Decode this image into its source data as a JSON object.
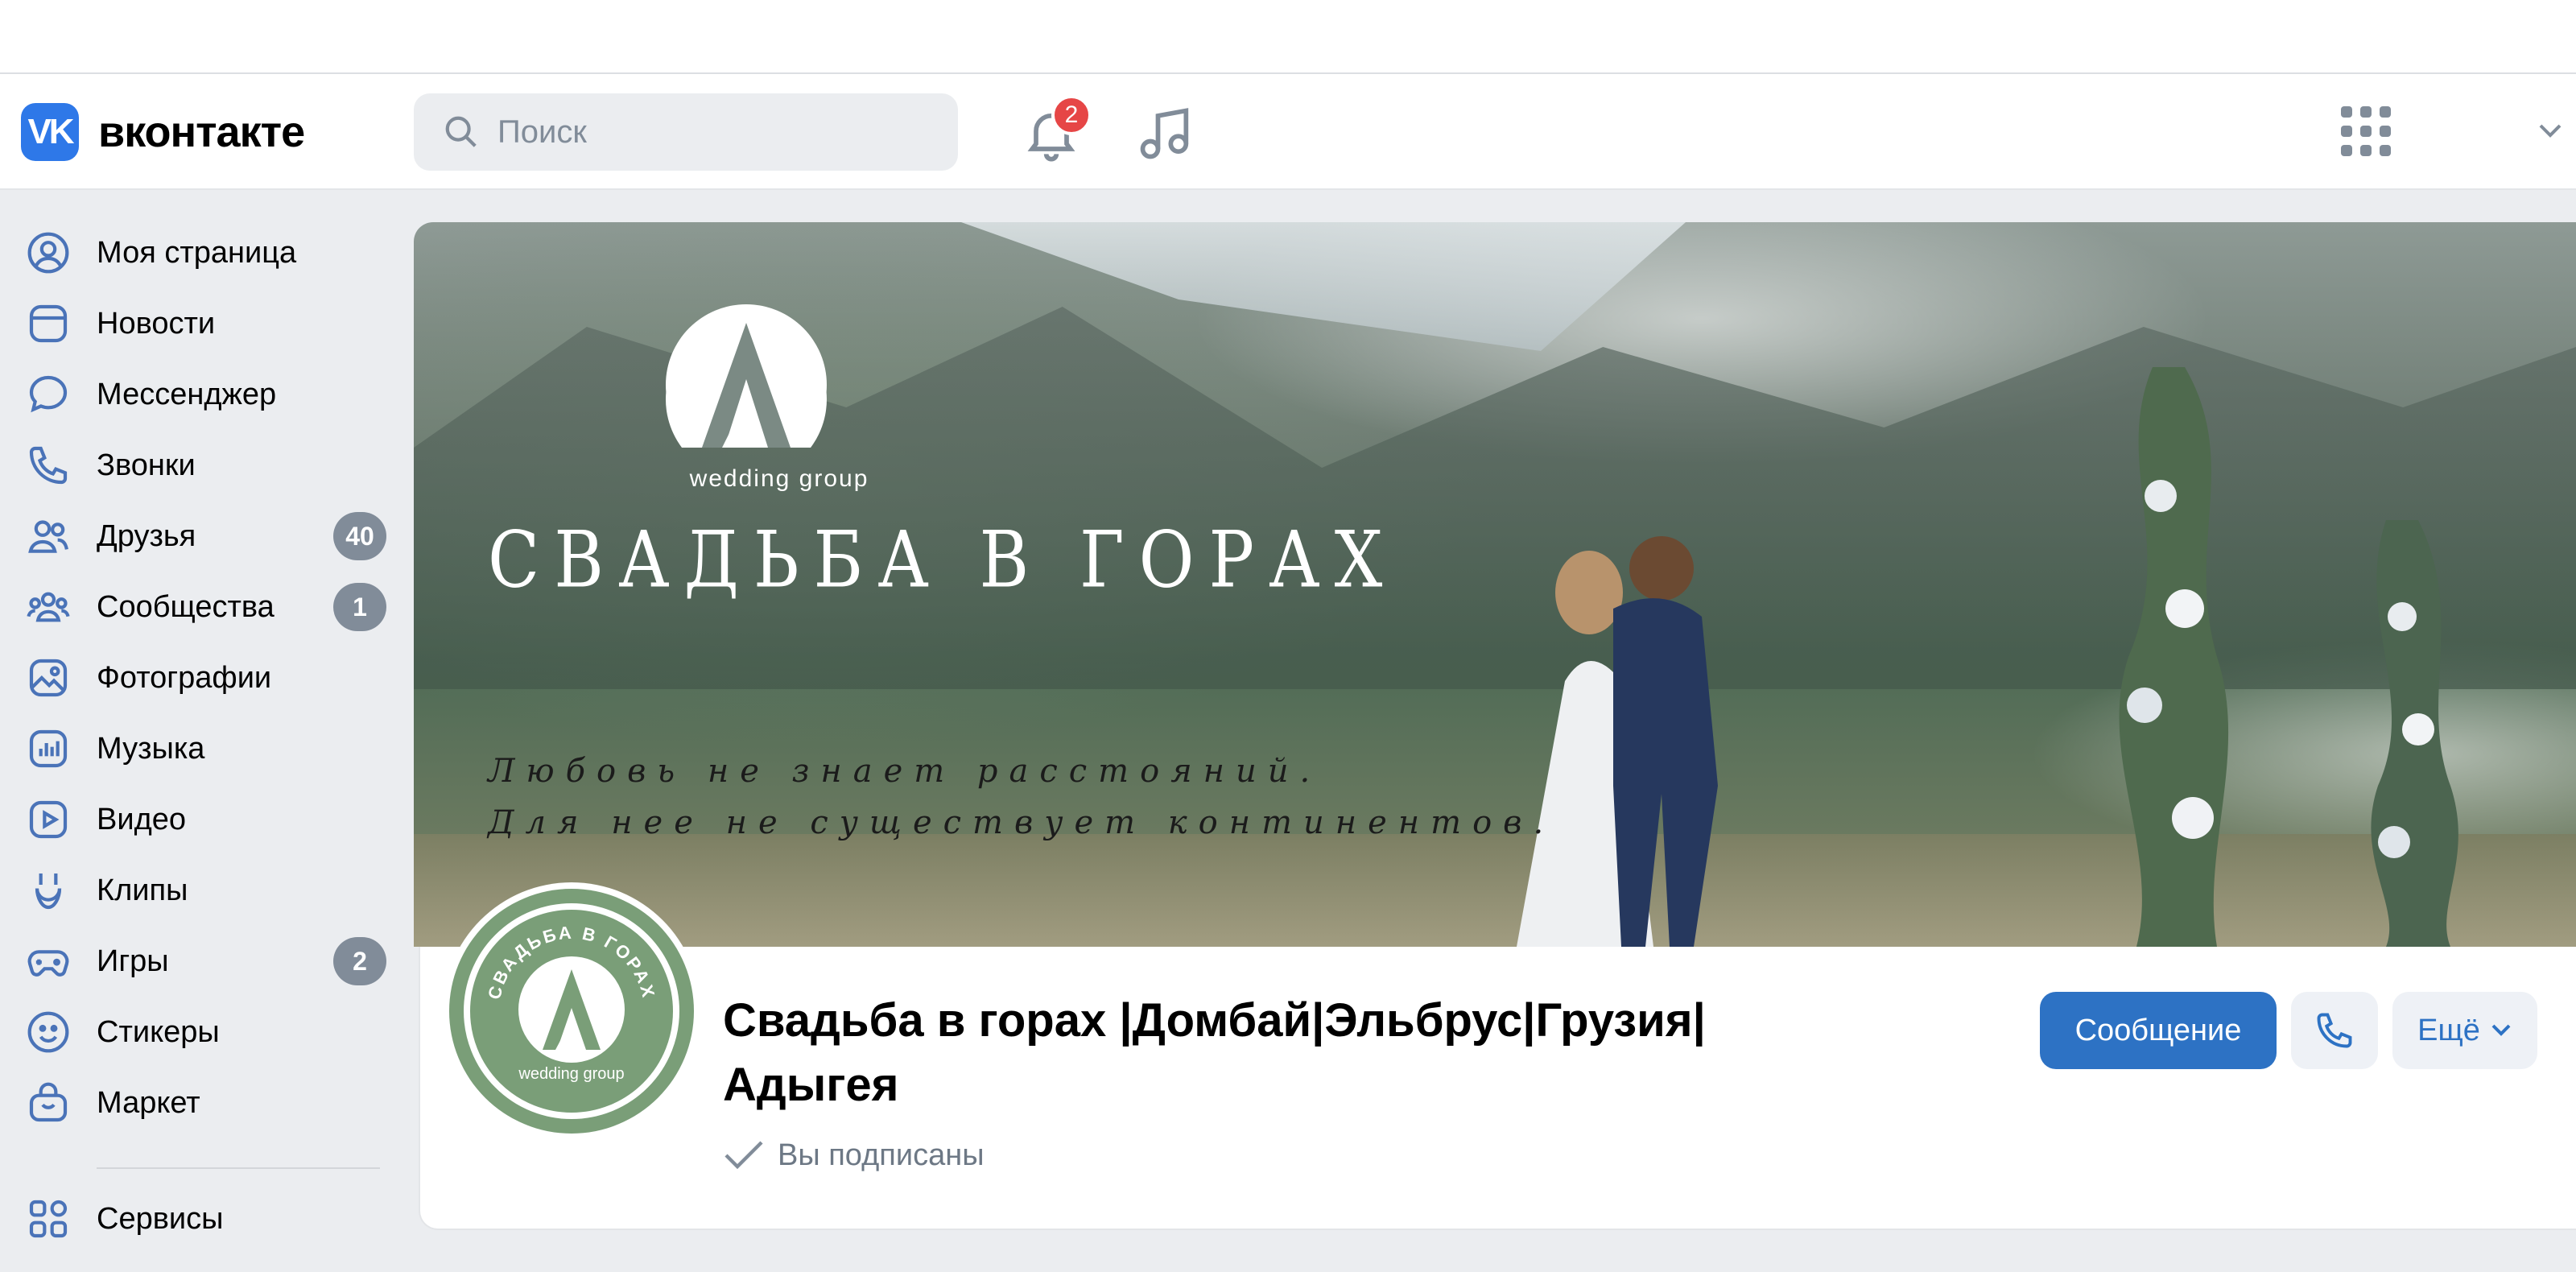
{
  "header": {
    "logo_text": "вконтакте",
    "search_placeholder": "Поиск",
    "notifications_count": "2"
  },
  "sidebar": {
    "items": [
      {
        "label": "Моя страница",
        "icon": "user-circle-icon"
      },
      {
        "label": "Новости",
        "icon": "news-icon"
      },
      {
        "label": "Мессенджер",
        "icon": "chat-bubble-icon"
      },
      {
        "label": "Звонки",
        "icon": "phone-icon"
      },
      {
        "label": "Друзья",
        "icon": "friends-icon",
        "count": "40"
      },
      {
        "label": "Сообщества",
        "icon": "communities-icon",
        "count": "1"
      },
      {
        "label": "Фотографии",
        "icon": "photo-icon"
      },
      {
        "label": "Музыка",
        "icon": "music-icon"
      },
      {
        "label": "Видео",
        "icon": "video-icon"
      },
      {
        "label": "Клипы",
        "icon": "clips-icon"
      },
      {
        "label": "Игры",
        "icon": "gamepad-icon",
        "count": "2"
      },
      {
        "label": "Стикеры",
        "icon": "smile-icon"
      },
      {
        "label": "Маркет",
        "icon": "bag-icon"
      },
      {
        "label": "Сервисы",
        "icon": "services-icon"
      }
    ]
  },
  "cover": {
    "brand_sub": "wedding group",
    "title": "СВАДЬБА В ГОРАХ",
    "quote_line1": "Любовь не знает расстояний.",
    "quote_line2": "Для нее не существует континентов."
  },
  "avatar": {
    "ring_text": "СВАДЬБА В ГОРАХ",
    "brand_sub": "wedding group"
  },
  "group": {
    "name": "Свадьба в горах |Домбай|Эльбрус|Грузия| Адыгея",
    "status": "Вы подписаны"
  },
  "actions": {
    "message_label": "Сообщение",
    "more_label": "Ещё"
  },
  "colors": {
    "accent": "#2d72c4",
    "logo": "#2e78e8",
    "badge": "#e64646",
    "avatar_bg": "#7a9e78"
  }
}
